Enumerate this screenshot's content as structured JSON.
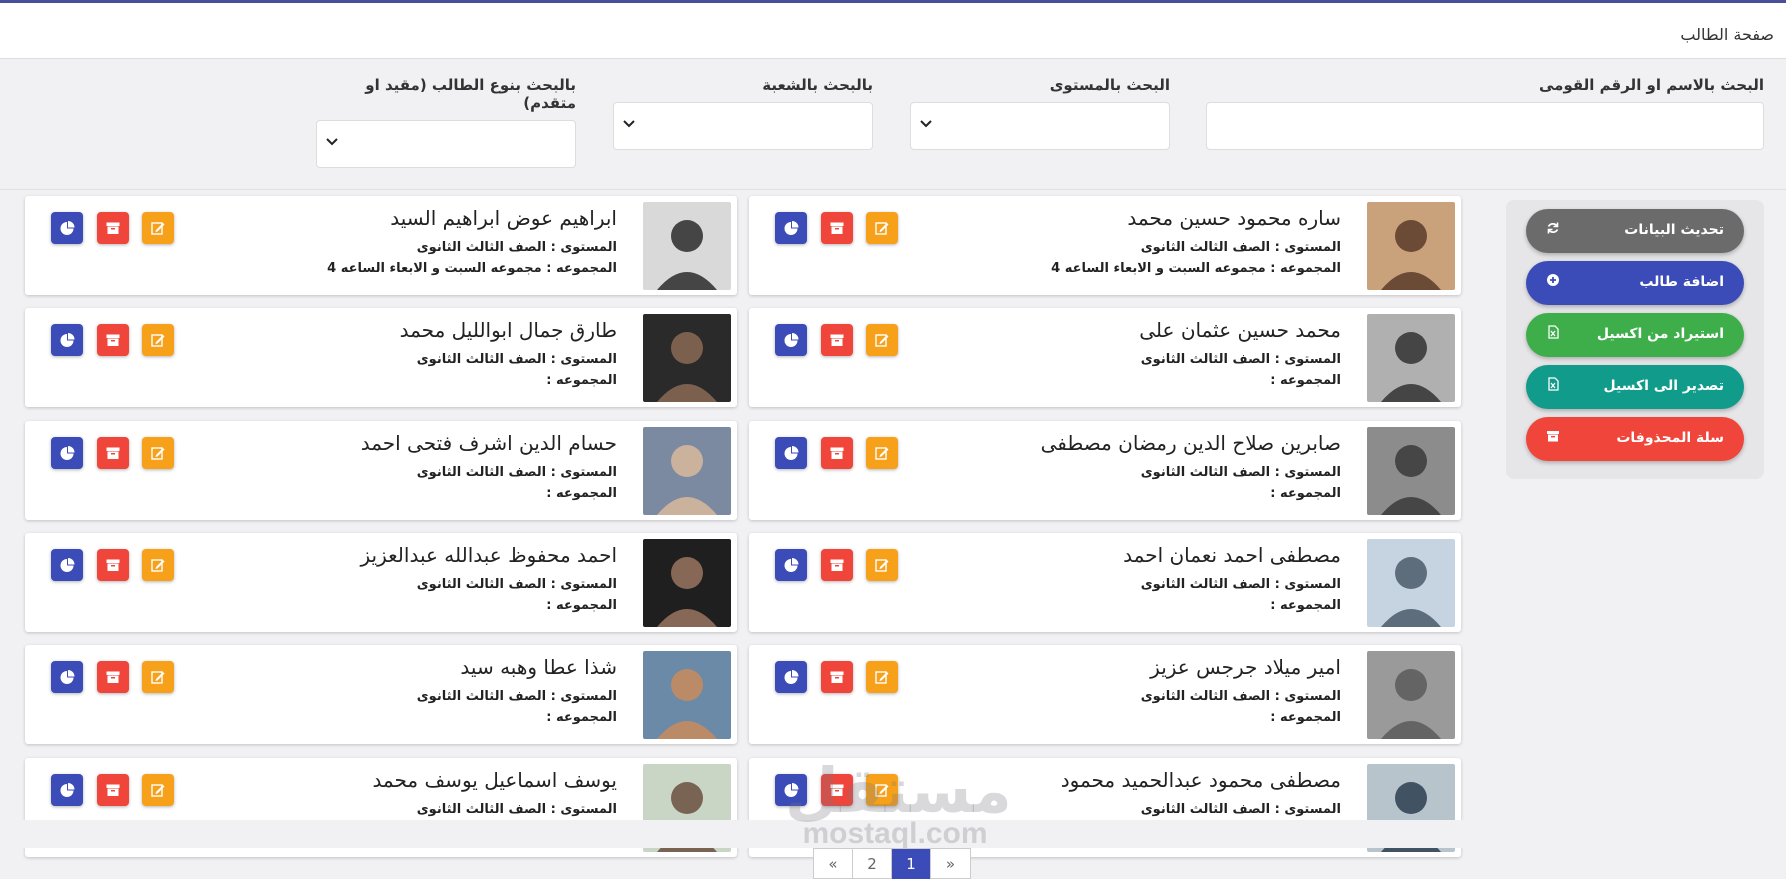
{
  "header": {
    "title": "صفحة الطالب"
  },
  "filters": {
    "name_search": {
      "label": "البحث بالاسم او الرقم القومى",
      "value": ""
    },
    "level_search": {
      "label": "البحث بالمستوى"
    },
    "division_search": {
      "label": "بالبحث بالشعبة"
    },
    "type_search": {
      "label": "بالبحث بنوع الطالب (مقيد او متقدم)"
    }
  },
  "sidebar": {
    "refresh": "تحديث البيانات",
    "add": "اضافة طالب",
    "import": "استيراد من اكسيل",
    "export": "تصدير الى اكسيل",
    "trash": "سلة المحذوفات"
  },
  "colors": {
    "refresh": "#6b6b6b",
    "add": "#3b4bb8",
    "import": "#3dae49",
    "export": "#109b8a",
    "trash": "#f0453a"
  },
  "students": [
    {
      "name": "ساره محمود حسين محمد",
      "level": "المستوى : الصف الثالث الثانوى",
      "group": "المجموعه : مجموعه السبت و الابعاء الساعه 4"
    },
    {
      "name": "ابراهيم عوض ابراهيم السيد",
      "level": "المستوى : الصف الثالث الثانوى",
      "group": "المجموعه : مجموعه السبت و الابعاء الساعه 4"
    },
    {
      "name": "محمد حسين عثمان على",
      "level": "المستوى : الصف الثالث الثانوى",
      "group": "المجموعه :"
    },
    {
      "name": "طارق جمال ابوالليل محمد",
      "level": "المستوى : الصف الثالث الثانوى",
      "group": "المجموعه :"
    },
    {
      "name": "صابرين صلاح الدين رمضان مصطفى",
      "level": "المستوى : الصف الثالث الثانوى",
      "group": "المجموعه :"
    },
    {
      "name": "حسام الدين اشرف فتحى احمد",
      "level": "المستوى : الصف الثالث الثانوى",
      "group": "المجموعه :"
    },
    {
      "name": "مصطفى احمد نعمان احمد",
      "level": "المستوى : الصف الثالث الثانوى",
      "group": "المجموعه :"
    },
    {
      "name": "احمد محفوظ عبدالله عبدالعزيز",
      "level": "المستوى : الصف الثالث الثانوى",
      "group": "المجموعه :"
    },
    {
      "name": "امير ميلاد جرجس عزيز",
      "level": "المستوى : الصف الثالث الثانوى",
      "group": "المجموعه :"
    },
    {
      "name": "شذا عطا وهبه سيد",
      "level": "المستوى : الصف الثالث الثانوى",
      "group": "المجموعه :"
    },
    {
      "name": "مصطفى محمود عبدالحميد محمود",
      "level": "المستوى : الصف الثالث الثانوى",
      "group": ""
    },
    {
      "name": "يوسف اسماعيل يوسف محمد",
      "level": "المستوى : الصف الثالث الثانوى",
      "group": ""
    }
  ],
  "pagination": {
    "prev": "«",
    "page2": "2",
    "page1": "1",
    "next": "»"
  },
  "watermark": {
    "arabic": "مستقل",
    "latin": "mostaql.com"
  }
}
